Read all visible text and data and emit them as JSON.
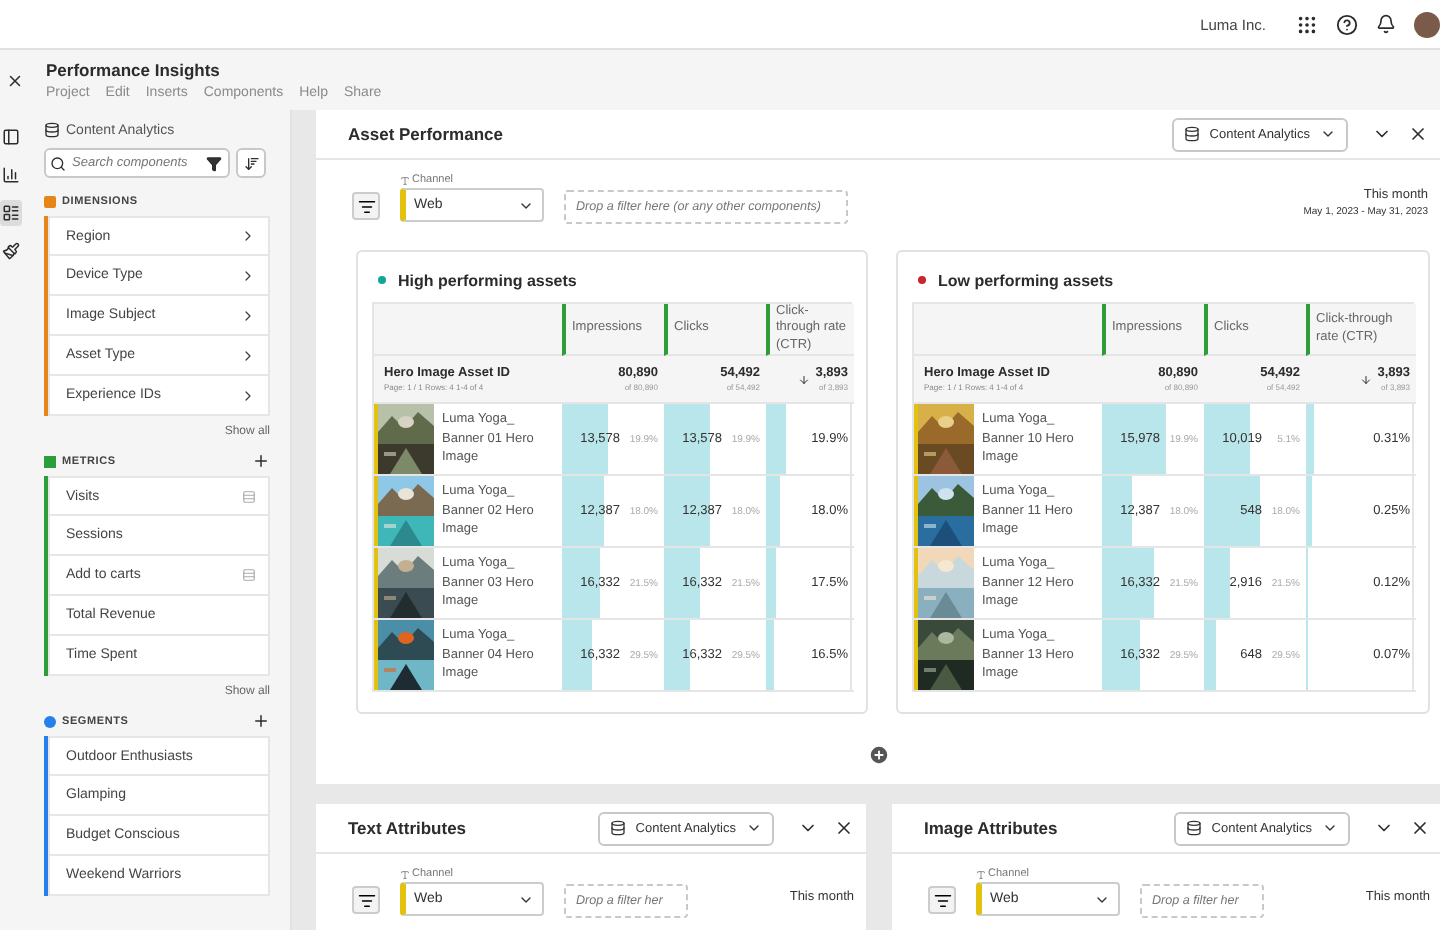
{
  "top_bar": {
    "org": "Luma Inc."
  },
  "project": {
    "title": "Performance Insights",
    "menu": [
      "Project",
      "Edit",
      "Inserts",
      "Components",
      "Help",
      "Share"
    ]
  },
  "rail": [
    {
      "kind": "panel",
      "selected": false
    },
    {
      "kind": "chart",
      "selected": false
    },
    {
      "kind": "components",
      "selected": true
    },
    {
      "kind": "brush",
      "selected": false
    }
  ],
  "sidebar": {
    "source": "Content Analytics",
    "search": {
      "placeholder": "Search components"
    },
    "sections": [
      {
        "kind": "dimensions",
        "title": "DIMENSIONS",
        "color": "#e68619",
        "addable": false,
        "show_all": "Show all",
        "items": [
          {
            "label": "Region",
            "kind": "expand"
          },
          {
            "label": "Device Type",
            "kind": "expand"
          },
          {
            "label": "Image Subject",
            "kind": "expand"
          },
          {
            "label": "Asset Type",
            "kind": "expand"
          },
          {
            "label": "Experience IDs",
            "kind": "expand"
          }
        ]
      },
      {
        "kind": "metrics",
        "title": "METRICS",
        "color": "#2d9d3a",
        "addable": true,
        "show_all": "Show all",
        "items": [
          {
            "label": "Visits",
            "kind": "calc"
          },
          {
            "label": "Sessions",
            "kind": "plain"
          },
          {
            "label": "Add to carts",
            "kind": "calc"
          },
          {
            "label": "Total Revenue",
            "kind": "plain"
          },
          {
            "label": "Time Spent",
            "kind": "plain"
          }
        ]
      },
      {
        "kind": "segments",
        "title": "SEGMENTS",
        "color": "#2680eb",
        "addable": true,
        "items": [
          {
            "label": "Outdoor Enthusiasts",
            "kind": "plain"
          },
          {
            "label": "Glamping",
            "kind": "plain"
          },
          {
            "label": "Budget Conscious",
            "kind": "plain"
          },
          {
            "label": "Weekend Warriors",
            "kind": "plain"
          }
        ]
      }
    ]
  },
  "main": {
    "title": "Asset Performance",
    "source": "Content Analytics",
    "filter_label": "Channel",
    "channel": "Web",
    "drop_placeholder": "Drop a filter here (or any other components)",
    "range": "This month",
    "dates": "May 1, 2023 - May 31, 2023",
    "tables": [
      {
        "title": "High performing assets",
        "color": "#12a39a",
        "columns": [
          "Impressions",
          "Clicks",
          "Click-through rate (CTR)"
        ],
        "dimension": "Hero Image Asset ID",
        "paging": "Page: 1 / 1 Rows: 4  1-4 of 4",
        "totals": [
          {
            "value": "80,890",
            "of": "of 80,890",
            "sorted": false
          },
          {
            "value": "54,492",
            "of": "of 54,492",
            "sorted": false
          },
          {
            "value": "3,893",
            "of": "of 3,893",
            "sorted": true
          }
        ],
        "rows": [
          {
            "name": "Luma Yoga_ Banner 01 Hero Image",
            "cells": [
              {
                "value": "13,578",
                "pct": "19.9%",
                "level": 0.45
              },
              {
                "value": "13,578",
                "pct": "19.9%",
                "level": 0.45
              },
              {
                "value": "19.9%",
                "level": 0.22
              }
            ]
          },
          {
            "name": "Luma Yoga_ Banner 02 Hero Image",
            "cells": [
              {
                "value": "12,387",
                "pct": "18.0%",
                "level": 0.42
              },
              {
                "value": "12,387",
                "pct": "18.0%",
                "level": 0.45
              },
              {
                "value": "18.0%",
                "level": 0.15
              }
            ]
          },
          {
            "name": "Luma Yoga_ Banner 03 Hero Image",
            "cells": [
              {
                "value": "16,332",
                "pct": "21.5%",
                "level": 0.37
              },
              {
                "value": "16,332",
                "pct": "21.5%",
                "level": 0.35
              },
              {
                "value": "17.5%",
                "level": 0.12
              }
            ]
          },
          {
            "name": "Luma Yoga_ Banner 04 Hero Image",
            "cells": [
              {
                "value": "16,332",
                "pct": "29.5%",
                "level": 0.3
              },
              {
                "value": "16,332",
                "pct": "29.5%",
                "level": 0.25
              },
              {
                "value": "16.5%",
                "level": 0.1
              }
            ]
          }
        ]
      },
      {
        "title": "Low performing assets",
        "color": "#c9252d",
        "columns": [
          "Impressions",
          "Clicks",
          "Click-through rate (CTR)"
        ],
        "dimension": "Hero Image Asset ID",
        "paging": "Page: 1 / 1 Rows: 4  1-4 of 4",
        "totals": [
          {
            "value": "80,890",
            "of": "of 80,890",
            "sorted": false
          },
          {
            "value": "54,492",
            "of": "of 54,492",
            "sorted": false
          },
          {
            "value": "3,893",
            "of": "of 3,893",
            "sorted": true
          }
        ],
        "rows": [
          {
            "name": "Luma Yoga_ Banner 10 Hero Image",
            "cells": [
              {
                "value": "15,978",
                "pct": "19.9%",
                "level": 0.62
              },
              {
                "value": "10,019",
                "pct": "5.1%",
                "level": 0.45
              },
              {
                "value": "0.31%",
                "level": 0.07
              }
            ]
          },
          {
            "name": "Luma Yoga_ Banner 11 Hero Image",
            "cells": [
              {
                "value": "12,387",
                "pct": "18.0%",
                "level": 0.3
              },
              {
                "value": "548",
                "pct": "18.0%",
                "level": 0.55
              },
              {
                "value": "0.25%",
                "level": 0.06
              }
            ]
          },
          {
            "name": "Luma Yoga_ Banner 12 Hero Image",
            "cells": [
              {
                "value": "16,332",
                "pct": "21.5%",
                "level": 0.5
              },
              {
                "value": "2,916",
                "pct": "21.5%",
                "level": 0.25
              },
              {
                "value": "0.12%",
                "level": 0.02
              }
            ]
          },
          {
            "name": "Luma Yoga_ Banner 13 Hero Image",
            "cells": [
              {
                "value": "16,332",
                "pct": "29.5%",
                "level": 0.38
              },
              {
                "value": "648",
                "pct": "29.5%",
                "level": 0.12
              },
              {
                "value": "0.07%",
                "level": 0.01
              }
            ]
          }
        ]
      }
    ]
  },
  "bottom_panels": [
    {
      "title": "Text Attributes",
      "source": "Content Analytics",
      "filter_label": "Channel",
      "channel": "Web",
      "drop_placeholder": "Drop a filter her",
      "range": "This month"
    },
    {
      "title": "Image Attributes",
      "source": "Content Analytics",
      "filter_label": "Channel",
      "channel": "Web",
      "drop_placeholder": "Drop a filter her",
      "range": "This month"
    }
  ]
}
